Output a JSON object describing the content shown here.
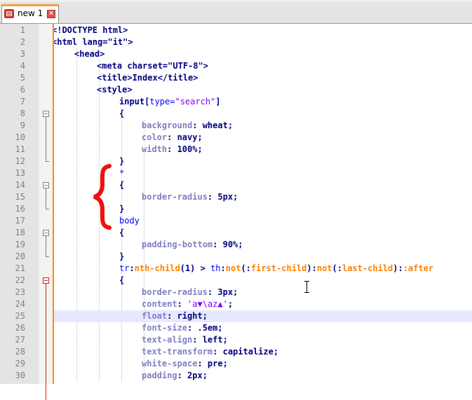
{
  "tab": {
    "label": "new 1",
    "close_glyph": "✕"
  },
  "accent_color": "#f4a040",
  "highlight_line": 25,
  "lines": [
    {
      "n": "1",
      "indent": 0,
      "parts": [
        [
          "t",
          "<!DOCTYPE html>"
        ]
      ]
    },
    {
      "n": "2",
      "indent": 0,
      "parts": [
        [
          "t",
          "<html lang=\"it\">"
        ]
      ]
    },
    {
      "n": "3",
      "indent": 1,
      "parts": [
        [
          "t",
          "<head>"
        ]
      ]
    },
    {
      "n": "4",
      "indent": 2,
      "parts": [
        [
          "t",
          "<meta charset=\"UTF-8\">"
        ]
      ]
    },
    {
      "n": "5",
      "indent": 2,
      "parts": [
        [
          "t",
          "<title>Index</title>"
        ]
      ]
    },
    {
      "n": "6",
      "indent": 2,
      "parts": [
        [
          "t",
          "<style>"
        ]
      ]
    },
    {
      "n": "7",
      "indent": 3,
      "parts": [
        [
          "t",
          "input["
        ],
        [
          "k",
          "type="
        ],
        [
          "s",
          "\"search\""
        ],
        [
          "t",
          "]"
        ]
      ]
    },
    {
      "n": "8",
      "indent": 3,
      "parts": [
        [
          "t",
          "{"
        ]
      ]
    },
    {
      "n": "9",
      "indent": 4,
      "parts": [
        [
          "p",
          "background"
        ],
        [
          "t",
          ": wheat;"
        ]
      ]
    },
    {
      "n": "10",
      "indent": 4,
      "parts": [
        [
          "p",
          "color"
        ],
        [
          "t",
          ": navy;"
        ]
      ]
    },
    {
      "n": "11",
      "indent": 4,
      "parts": [
        [
          "p",
          "width"
        ],
        [
          "t",
          ": 100%;"
        ]
      ]
    },
    {
      "n": "12",
      "indent": 3,
      "parts": [
        [
          "t",
          "}"
        ]
      ]
    },
    {
      "n": "13",
      "indent": 3,
      "parts": [
        [
          "k",
          "*"
        ]
      ]
    },
    {
      "n": "14",
      "indent": 3,
      "parts": [
        [
          "t",
          "{"
        ]
      ]
    },
    {
      "n": "15",
      "indent": 4,
      "parts": [
        [
          "p",
          "border-radius"
        ],
        [
          "t",
          ": 5px;"
        ]
      ]
    },
    {
      "n": "16",
      "indent": 3,
      "parts": [
        [
          "t",
          "}"
        ]
      ]
    },
    {
      "n": "17",
      "indent": 3,
      "parts": [
        [
          "k",
          "body"
        ]
      ]
    },
    {
      "n": "18",
      "indent": 3,
      "parts": [
        [
          "t",
          "{"
        ]
      ]
    },
    {
      "n": "19",
      "indent": 4,
      "parts": [
        [
          "p",
          "padding-bottom"
        ],
        [
          "t",
          ": 90%;"
        ]
      ]
    },
    {
      "n": "20",
      "indent": 3,
      "parts": [
        [
          "t",
          "}"
        ]
      ]
    },
    {
      "n": "21",
      "indent": 3,
      "parts": [
        [
          "k",
          "tr"
        ],
        [
          "t",
          ":"
        ],
        [
          "ps",
          "nth-child"
        ],
        [
          "t",
          "(1) > "
        ],
        [
          "k",
          "th"
        ],
        [
          "t",
          ":"
        ],
        [
          "ps",
          "not"
        ],
        [
          "t",
          "(:"
        ],
        [
          "ps",
          "first-child"
        ],
        [
          "t",
          "):"
        ],
        [
          "ps",
          "not"
        ],
        [
          "t",
          "(:"
        ],
        [
          "ps",
          "last-child"
        ],
        [
          "t",
          "):"
        ],
        [
          "ps",
          ":after"
        ]
      ]
    },
    {
      "n": "22",
      "indent": 3,
      "parts": [
        [
          "t",
          "{"
        ]
      ]
    },
    {
      "n": "23",
      "indent": 4,
      "parts": [
        [
          "p",
          "border-radius"
        ],
        [
          "t",
          ": 3px;"
        ]
      ]
    },
    {
      "n": "24",
      "indent": 4,
      "parts": [
        [
          "p",
          "content"
        ],
        [
          "t",
          ": "
        ],
        [
          "s",
          "'a▼\\az▲'"
        ],
        [
          "t",
          ";"
        ]
      ]
    },
    {
      "n": "25",
      "indent": 4,
      "parts": [
        [
          "p",
          "float"
        ],
        [
          "t",
          ": right;"
        ]
      ]
    },
    {
      "n": "26",
      "indent": 4,
      "parts": [
        [
          "p",
          "font-size"
        ],
        [
          "t",
          ": .5em;"
        ]
      ]
    },
    {
      "n": "27",
      "indent": 4,
      "parts": [
        [
          "p",
          "text-align"
        ],
        [
          "t",
          ": left;"
        ]
      ]
    },
    {
      "n": "28",
      "indent": 4,
      "parts": [
        [
          "p",
          "text-transform"
        ],
        [
          "t",
          ": capitalize;"
        ]
      ]
    },
    {
      "n": "29",
      "indent": 4,
      "parts": [
        [
          "p",
          "white-space"
        ],
        [
          "t",
          ": pre;"
        ]
      ]
    },
    {
      "n": "30",
      "indent": 4,
      "parts": [
        [
          "p",
          "padding"
        ],
        [
          "t",
          ": 2px;"
        ]
      ]
    }
  ]
}
